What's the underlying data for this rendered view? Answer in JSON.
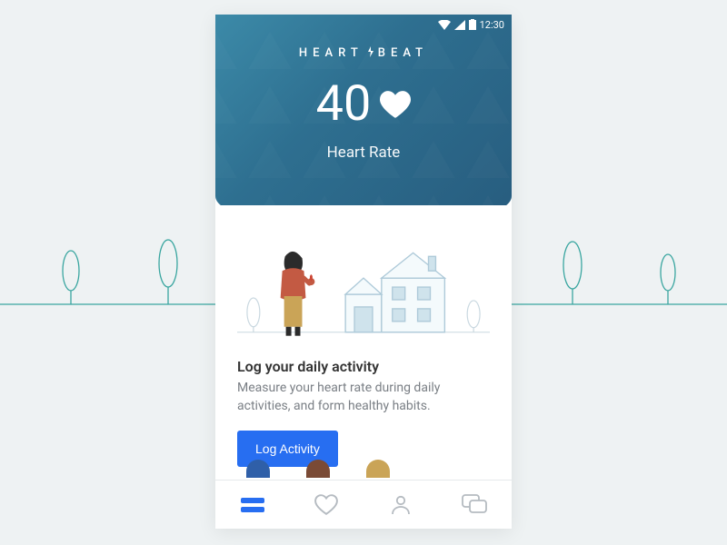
{
  "statusbar": {
    "time": "12:30"
  },
  "brand": {
    "part1": "HEART",
    "part2": "BEAT"
  },
  "metric": {
    "value": "40",
    "label": "Heart Rate"
  },
  "card": {
    "title": "Log your daily activity",
    "body": "Measure your heart rate during daily activities, and form healthy habits.",
    "cta": "Log Activity"
  },
  "nav": {
    "items": [
      {
        "name": "home",
        "active": true
      },
      {
        "name": "favorites",
        "active": false
      },
      {
        "name": "profile",
        "active": false
      },
      {
        "name": "chat",
        "active": false
      }
    ]
  },
  "colors": {
    "accent": "#276ef1",
    "header_gradient_start": "#3c8aa8",
    "header_gradient_end": "#275c7e",
    "bg": "#eef2f3"
  }
}
